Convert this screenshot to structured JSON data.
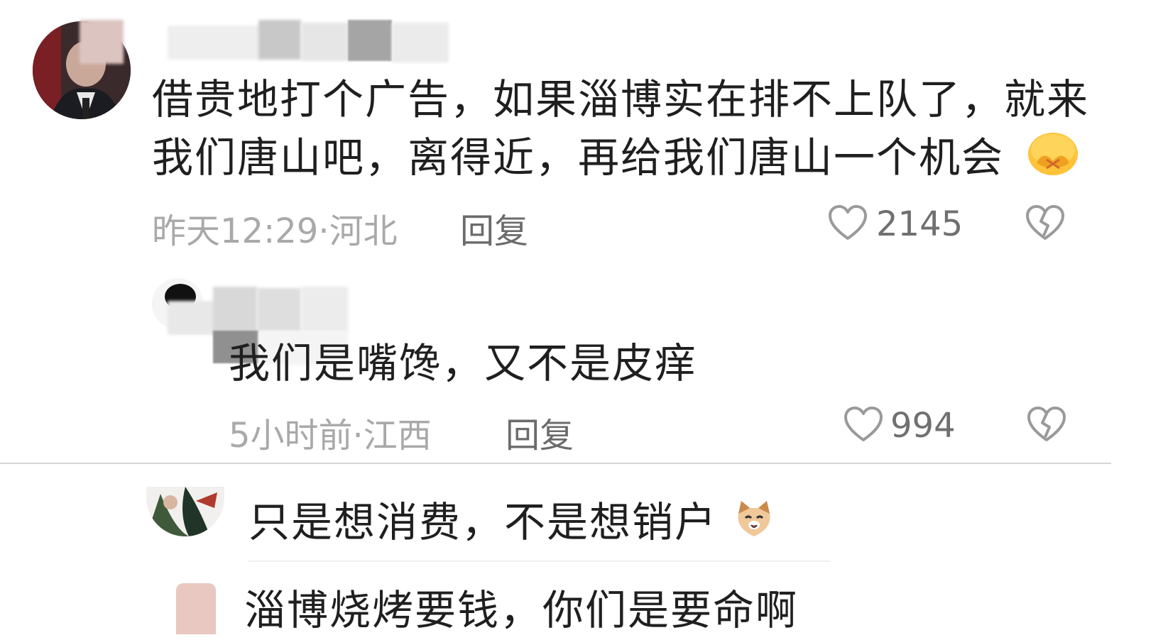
{
  "comments": [
    {
      "text_line1": "借贵地打个广告，如果淄博实在排不上队了，就来",
      "text_line2": "我们唐山吧，离得近，再给我们唐山一个机会",
      "meta": "昨天12:29·河北",
      "reply_label": "回复",
      "likes": "2145"
    },
    {
      "text": "我们是嘴馋，又不是皮痒",
      "meta": "5小时前·江西",
      "reply_label": "回复",
      "likes": "994"
    }
  ],
  "replies": [
    {
      "text": "只是想消费，不是想销户"
    },
    {
      "text": "淄博烧烤要钱，你们是要命啊"
    }
  ],
  "icons": {
    "like": "heart-outline-icon",
    "dislike": "broken-heart-icon",
    "emoji1": "blushing-face-emoji",
    "emoji2": "cat-face-emoji"
  },
  "colors": {
    "text": "#1f1f1f",
    "meta": "#a9a9a9",
    "reply": "#6b6b6b",
    "divider": "#d6d6d6"
  }
}
